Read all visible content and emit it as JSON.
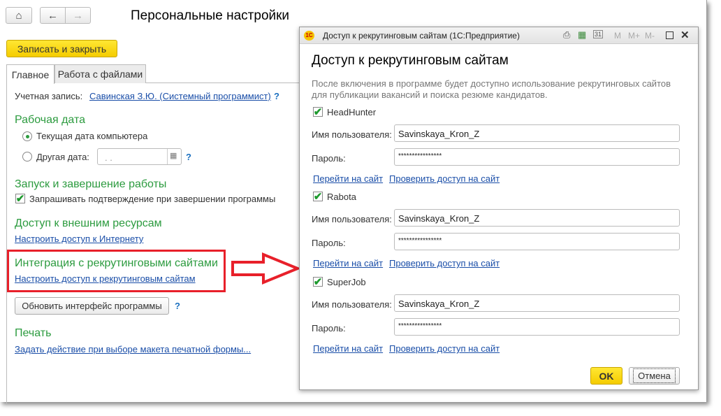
{
  "main": {
    "title": "Персональные настройки",
    "save_close": "Записать и закрыть",
    "tabs": [
      "Главное",
      "Работа с файлами"
    ],
    "account_label": "Учетная запись:",
    "account_value": "Савинская З.Ю. (Системный программист)",
    "help": "?",
    "work_date": {
      "heading": "Рабочая дата",
      "option_current": "Текущая дата компьютера",
      "option_other": "Другая дата:",
      "date_value": " .  . "
    },
    "startup": {
      "heading": "Запуск и завершение работы",
      "confirm_exit": "Запрашивать подтверждение при завершении программы"
    },
    "external": {
      "heading": "Доступ к внешним ресурсам",
      "link": "Настроить доступ к Интернету"
    },
    "recruit": {
      "heading": "Интеграция с рекрутинговыми сайтами",
      "link": "Настроить доступ к рекрутинговым сайтам"
    },
    "refresh_button": "Обновить интерфейс программы",
    "print": {
      "heading": "Печать",
      "link": "Задать действие при выборе макета печатной формы..."
    }
  },
  "dialog": {
    "window_title": "Доступ к рекрутинговым сайтам  (1С:Предприятие)",
    "toolbar": [
      "M",
      "M+",
      "M-"
    ],
    "heading": "Доступ к рекрутинговым сайтам",
    "description": [
      "После включения в программе будет доступно использование рекрутинговых сайтов",
      "для публикации вакансий и поиска резюме кандидатов."
    ],
    "user_label": "Имя пользователя:",
    "password_label": "Пароль:",
    "goto_link": "Перейти на сайт",
    "check_link": "Проверить доступ на сайт",
    "sites": [
      {
        "name": "HeadHunter",
        "user": "Savinskaya_Kron_Z",
        "password": "****************"
      },
      {
        "name": "Rabota",
        "user": "Savinskaya_Kron_Z",
        "password": "****************"
      },
      {
        "name": "SuperJob",
        "user": "Savinskaya_Kron_Z",
        "password": "****************"
      }
    ],
    "ok": "OK",
    "cancel": "Отмена"
  },
  "colors": {
    "accent": "#f5cc00",
    "section": "#2c9b3f",
    "link": "#1a4ea8",
    "highlight": "#e8202a"
  }
}
